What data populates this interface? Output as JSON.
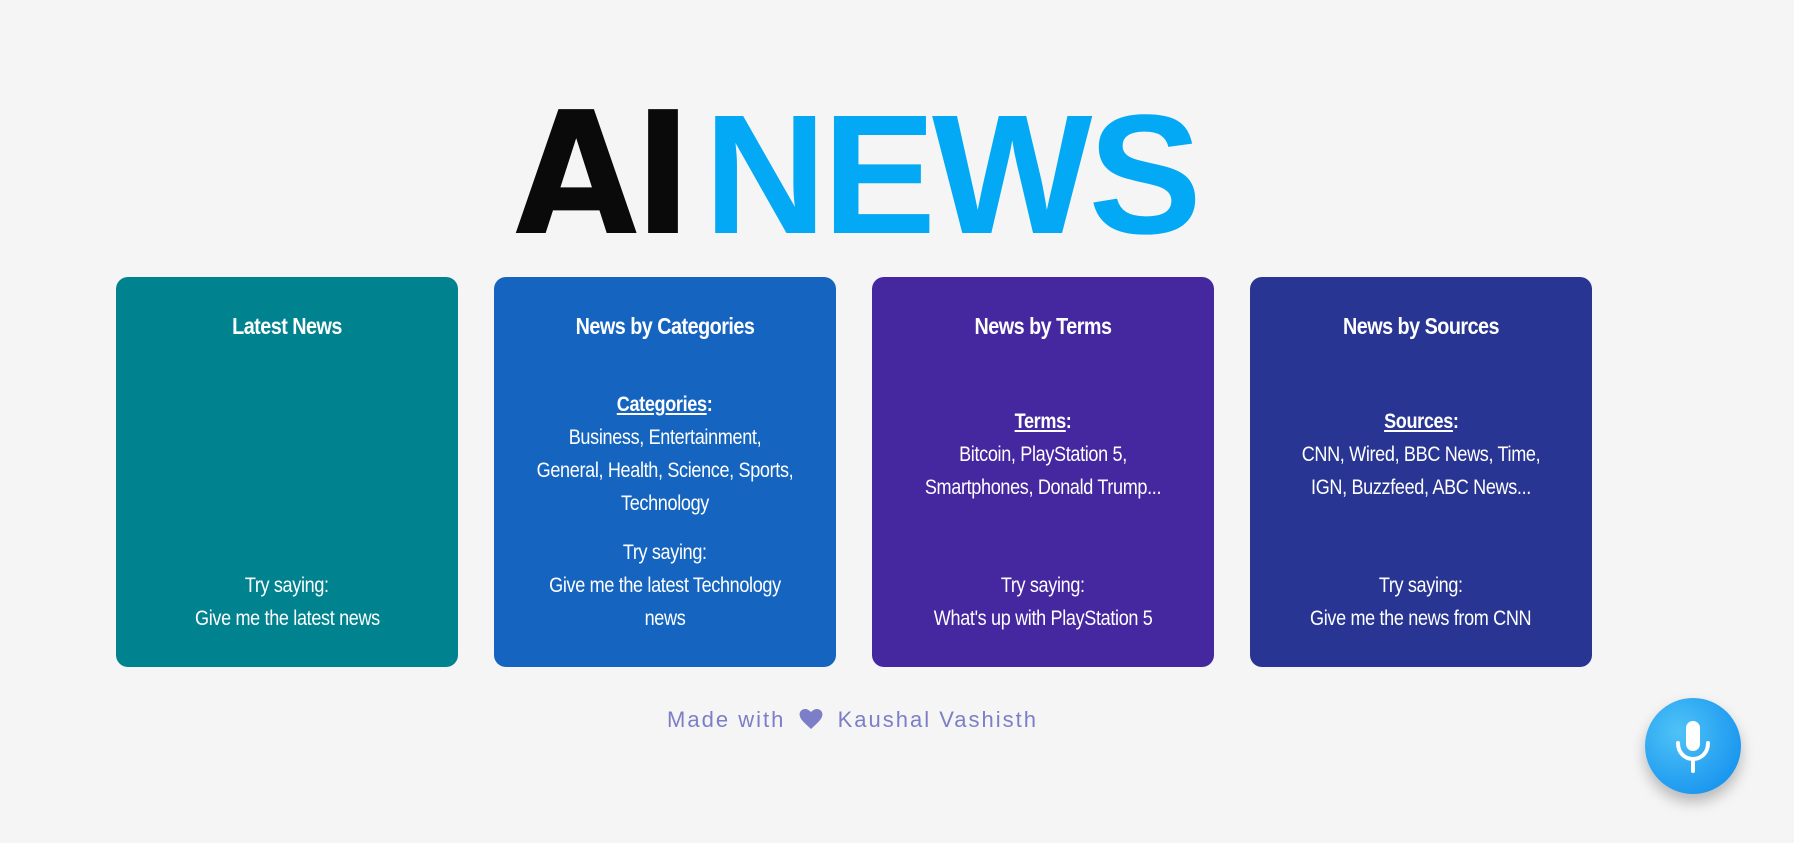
{
  "logo": {
    "part1": "AI",
    "part2": "NEWS"
  },
  "cards": [
    {
      "title": "Latest News",
      "info_label": "",
      "info_text": "",
      "try_label": "Try saying:",
      "try_text": "Give me the latest news",
      "color": "#00838f"
    },
    {
      "title": "News by Categories",
      "info_label": "Categories",
      "info_text": "Business, Entertainment, General, Health, Science, Sports, Technology",
      "try_label": "Try saying:",
      "try_text": "Give me the latest Technology news",
      "color": "#1565c0"
    },
    {
      "title": "News by Terms",
      "info_label": "Terms",
      "info_text": "Bitcoin, PlayStation 5, Smartphones, Donald Trump...",
      "try_label": "Try saying:",
      "try_text": "What's up with PlayStation 5",
      "color": "#4527a0"
    },
    {
      "title": "News by Sources",
      "info_label": "Sources",
      "info_text": "CNN, Wired, BBC News, Time, IGN, Buzzfeed, ABC News...",
      "try_label": "Try saying:",
      "try_text": "Give me the news from CNN",
      "color": "#283593"
    }
  ],
  "footer": {
    "prefix": "Made with",
    "heart_icon": "heart-icon",
    "author": "Kaushal Vashisth"
  },
  "mic_button": {
    "icon": "microphone-icon"
  }
}
